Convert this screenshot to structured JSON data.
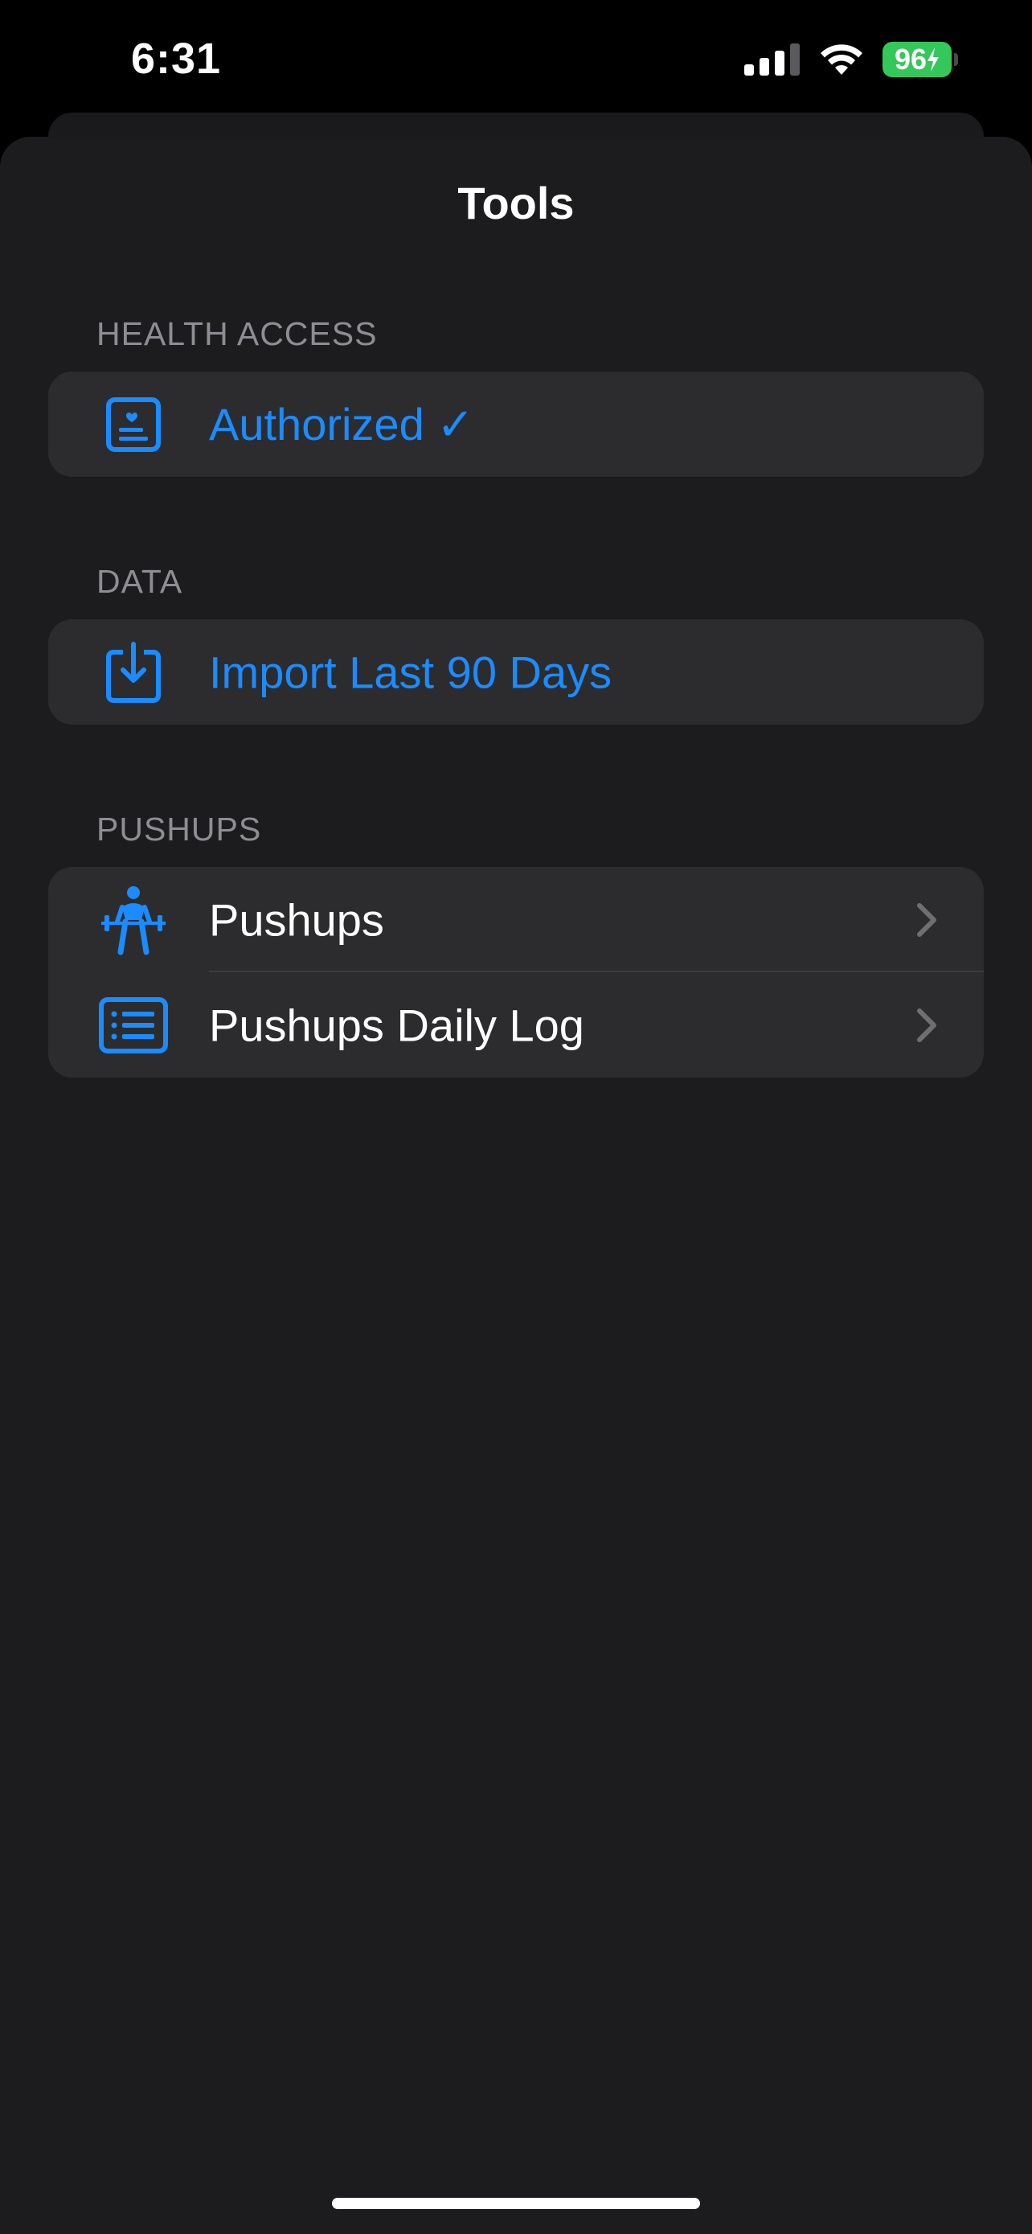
{
  "status_bar": {
    "time": "6:31",
    "battery": "96",
    "battery_color": "#34c759"
  },
  "sheet": {
    "title": "Tools"
  },
  "sections": {
    "health": {
      "header": "HEALTH ACCESS",
      "item_label": "Authorized ✓",
      "item_icon": "health-record-icon"
    },
    "data": {
      "header": "DATA",
      "item_label": "Import Last 90 Days",
      "item_icon": "import-tray-icon"
    },
    "pushups": {
      "header": "PUSHUPS",
      "items": [
        {
          "label": "Pushups",
          "icon": "weightlifter-icon"
        },
        {
          "label": "Pushups Daily Log",
          "icon": "list-icon"
        }
      ]
    }
  },
  "colors": {
    "accent": "#1a8cff",
    "sheet_bg": "#1c1c1e",
    "row_bg": "#2c2c2e",
    "section_header": "#8d8d93"
  }
}
